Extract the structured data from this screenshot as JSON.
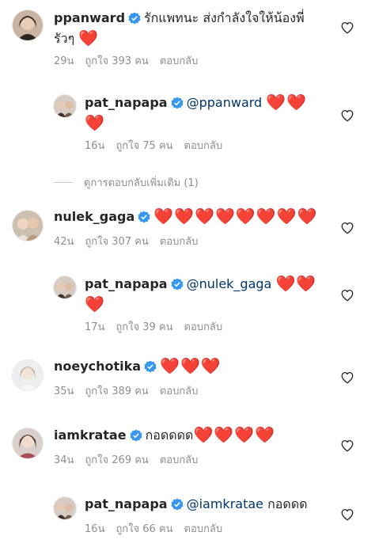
{
  "comments": [
    {
      "username": "ppanward",
      "text_line1": "รักแพทนะ ส่งกำลังใจให้น้องพี่",
      "text_line2": "รัวๆ",
      "hearts": "❤️",
      "time": "29น",
      "likes": "ถูกใจ 393 คน",
      "reply": "ตอบกลับ"
    },
    {
      "username": "pat_napapa",
      "mention": "@ppanward",
      "hearts_line1": "❤️❤️",
      "hearts_line2": "❤️",
      "time": "16น",
      "likes": "ถูกใจ 75 คน",
      "reply": "ตอบกลับ"
    },
    {
      "username": "nulek_gaga",
      "hearts": "❤️❤️❤️❤️❤️❤️❤️❤️",
      "time": "42น",
      "likes": "ถูกใจ 307 คน",
      "reply": "ตอบกลับ"
    },
    {
      "username": "pat_napapa",
      "mention": "@nulek_gaga",
      "hearts_line1": "❤️❤️",
      "hearts_line2": "❤️",
      "time": "17น",
      "likes": "ถูกใจ 39 คน",
      "reply": "ตอบกลับ"
    },
    {
      "username": "noeychotika",
      "hearts": "❤️❤️❤️",
      "time": "35น",
      "likes": "ถูกใจ 389 คน",
      "reply": "ตอบกลับ"
    },
    {
      "username": "iamkratae",
      "text": "กอดดดด",
      "hearts": "❤️❤️❤️❤️",
      "time": "34น",
      "likes": "ถูกใจ 269 คน",
      "reply": "ตอบกลับ"
    },
    {
      "username": "pat_napapa",
      "mention": "@iamkratae",
      "text": "กอดดด",
      "time": "16น",
      "likes": "ถูกใจ 66 คน",
      "reply": "ตอบกลับ"
    }
  ],
  "view_replies": "ดูการตอบกลับเพิ่มเติม (1)",
  "icons": {
    "verified": "verified-badge-icon",
    "like": "heart-outline-icon"
  },
  "colors": {
    "verified": "#3897f0",
    "heart": "#ed4956",
    "mention": "#00376b",
    "meta": "#8e8e8e"
  }
}
